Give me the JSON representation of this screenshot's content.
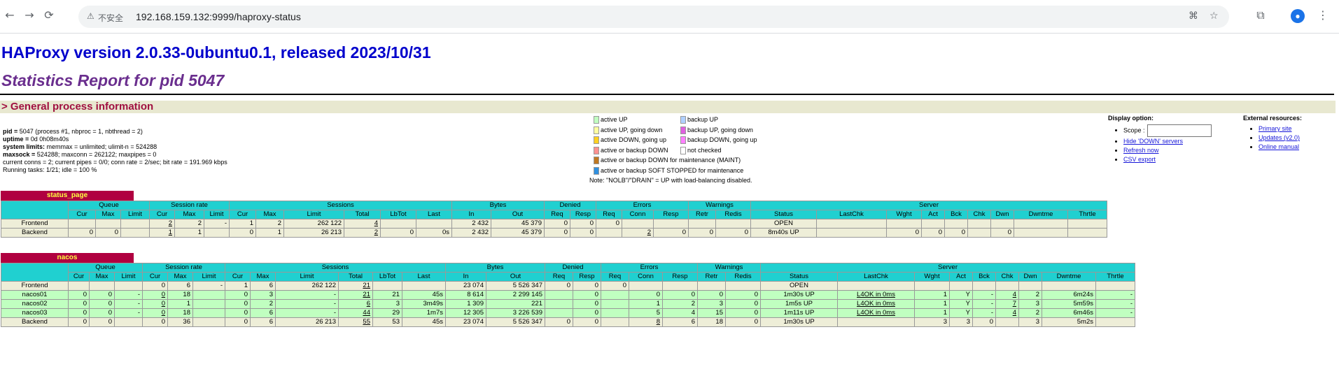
{
  "browser": {
    "back": "←",
    "forward": "→",
    "reload": "⟳",
    "security_label": "不安全",
    "url": "192.168.159.132:9999/haproxy-status"
  },
  "header": {
    "title": "HAProxy version 2.0.33-0ubuntu0.1, released 2023/10/31",
    "subtitle": "Statistics Report for pid 5047"
  },
  "general": {
    "section_title": "> General process information",
    "lines": [
      {
        "k": "pid = ",
        "v": "5047 (process #1, nbproc = 1, nbthread = 2)"
      },
      {
        "k": "uptime = ",
        "v": "0d 0h08m40s"
      },
      {
        "k": "system limits:",
        "v": " memmax = unlimited; ulimit-n = 524288"
      },
      {
        "k": "maxsock = ",
        "v": "524288; maxconn = 262122; maxpipes = 0"
      },
      {
        "k": "",
        "v": "current conns = 2; current pipes = 0/0; conn rate = 2/sec; bit rate = 191.969 kbps"
      },
      {
        "k": "",
        "v": "Running tasks: 1/21; idle = 100 %"
      }
    ]
  },
  "legend": {
    "left": [
      {
        "label": "active UP",
        "color": "#c0ffc0"
      },
      {
        "label": "active UP, going down",
        "color": "#ffffa0"
      },
      {
        "label": "active DOWN, going up",
        "color": "#ffd020"
      },
      {
        "label": "active or backup DOWN",
        "color": "#ff9090"
      },
      {
        "label": "active or backup DOWN for maintenance (MAINT)",
        "color": "#c07820"
      },
      {
        "label": "active or backup SOFT STOPPED for maintenance",
        "color": "#3090e0"
      }
    ],
    "right": [
      {
        "label": "backup UP",
        "color": "#b0d0ff"
      },
      {
        "label": "backup UP, going down",
        "color": "#e060e0"
      },
      {
        "label": "backup DOWN, going up",
        "color": "#ff80ff"
      },
      {
        "label": "not checked",
        "color": "#ffffff"
      }
    ],
    "note": "Note: \"NOLB\"/\"DRAIN\" = UP with load-balancing disabled."
  },
  "display_options": {
    "title": "Display option:",
    "scope_label": "Scope :",
    "links": [
      "Hide 'DOWN' servers",
      "Refresh now",
      "CSV export"
    ]
  },
  "external": {
    "title": "External resources:",
    "links": [
      "Primary site",
      "Updates (v2.0)",
      "Online manual"
    ]
  },
  "headers": {
    "groups": [
      "Queue",
      "Session rate",
      "Sessions",
      "Bytes",
      "Denied",
      "Errors",
      "Warnings",
      "Server"
    ],
    "cols": [
      "Cur",
      "Max",
      "Limit",
      "Cur",
      "Max",
      "Limit",
      "Cur",
      "Max",
      "Limit",
      "Total",
      "LbTot",
      "Last",
      "In",
      "Out",
      "Req",
      "Resp",
      "Req",
      "Conn",
      "Resp",
      "Retr",
      "Redis",
      "Status",
      "LastChk",
      "Wght",
      "Act",
      "Bck",
      "Chk",
      "Dwn",
      "Dwntme",
      "Thrtle"
    ]
  },
  "proxies": [
    {
      "name": "status_page",
      "rows": [
        {
          "kind": "fe",
          "cells": [
            "Frontend",
            "",
            "",
            "",
            "2",
            "2",
            "-",
            "1",
            "2",
            "262 122",
            "4",
            "",
            "",
            "2 432",
            "45 379",
            "0",
            "0",
            "0",
            "",
            "",
            "",
            "",
            "OPEN",
            "",
            "",
            "",
            "",
            "",
            "",
            "",
            ""
          ]
        },
        {
          "kind": "be",
          "cells": [
            "Backend",
            "0",
            "0",
            "",
            "1",
            "1",
            "",
            "0",
            "1",
            "26 213",
            "2",
            "0",
            "0s",
            "2 432",
            "45 379",
            "0",
            "0",
            "",
            "2",
            "0",
            "0",
            "0",
            "8m40s UP",
            "",
            "0",
            "0",
            "0",
            "",
            "0",
            "",
            ""
          ]
        }
      ]
    },
    {
      "name": "nacos",
      "rows": [
        {
          "kind": "fe",
          "cells": [
            "Frontend",
            "",
            "",
            "",
            "0",
            "6",
            "-",
            "1",
            "6",
            "262 122",
            "21",
            "",
            "",
            "23 074",
            "5 526 347",
            "0",
            "0",
            "0",
            "",
            "",
            "",
            "",
            "OPEN",
            "",
            "",
            "",
            "",
            "",
            "",
            "",
            ""
          ]
        },
        {
          "kind": "up",
          "cells": [
            "nacos01",
            "0",
            "0",
            "-",
            "0",
            "18",
            "",
            "0",
            "3",
            "-",
            "21",
            "21",
            "45s",
            "8 614",
            "2 299 145",
            "",
            "0",
            "",
            "0",
            "0",
            "0",
            "0",
            "1m30s UP",
            "L4OK in 0ms",
            "1",
            "Y",
            "-",
            "4",
            "2",
            "6m24s",
            "-"
          ]
        },
        {
          "kind": "up",
          "cells": [
            "nacos02",
            "0",
            "0",
            "-",
            "0",
            "1",
            "",
            "0",
            "2",
            "-",
            "6",
            "3",
            "3m49s",
            "1 309",
            "221",
            "",
            "0",
            "",
            "1",
            "2",
            "3",
            "0",
            "1m5s UP",
            "L4OK in 0ms",
            "1",
            "Y",
            "-",
            "7",
            "3",
            "5m59s",
            "-"
          ]
        },
        {
          "kind": "up",
          "cells": [
            "nacos03",
            "0",
            "0",
            "-",
            "0",
            "18",
            "",
            "0",
            "6",
            "-",
            "44",
            "29",
            "1m7s",
            "12 305",
            "3 226 539",
            "",
            "0",
            "",
            "5",
            "4",
            "15",
            "0",
            "1m11s UP",
            "L4OK in 0ms",
            "1",
            "Y",
            "-",
            "4",
            "2",
            "6m46s",
            "-"
          ]
        },
        {
          "kind": "be",
          "cells": [
            "Backend",
            "0",
            "0",
            "",
            "0",
            "36",
            "",
            "0",
            "6",
            "26 213",
            "55",
            "53",
            "45s",
            "23 074",
            "5 526 347",
            "0",
            "0",
            "",
            "8",
            "6",
            "18",
            "0",
            "1m30s UP",
            "",
            "3",
            "3",
            "0",
            "",
            "3",
            "5m2s",
            ""
          ]
        }
      ]
    }
  ]
}
